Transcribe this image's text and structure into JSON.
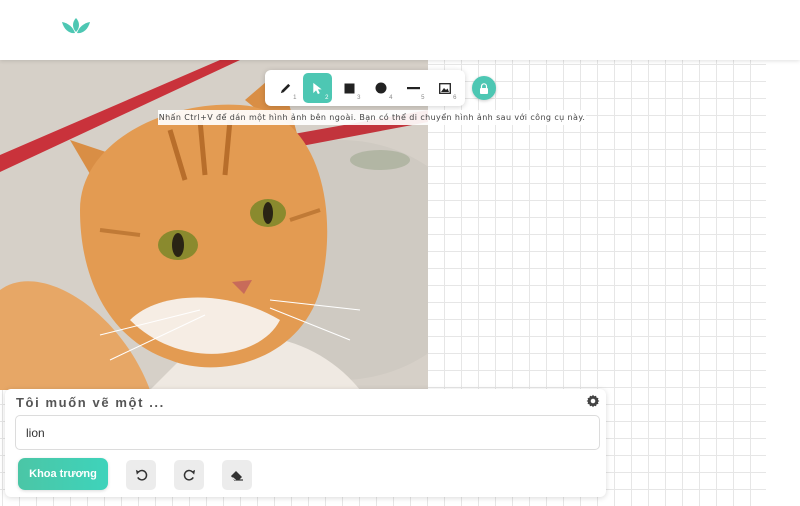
{
  "header": {
    "logo_icon": "leaf-logo-icon",
    "brand_color": "#4dc7b3"
  },
  "toolbar": {
    "tools": [
      {
        "name": "pencil",
        "icon": "pencil-icon",
        "shortcut": "1",
        "active": false
      },
      {
        "name": "select",
        "icon": "pointer-icon",
        "shortcut": "2",
        "active": true
      },
      {
        "name": "rectangle",
        "icon": "square-icon",
        "shortcut": "3",
        "active": false
      },
      {
        "name": "circle",
        "icon": "circle-icon",
        "shortcut": "4",
        "active": false
      },
      {
        "name": "line",
        "icon": "line-icon",
        "shortcut": "5",
        "active": false
      },
      {
        "name": "image",
        "icon": "image-icon",
        "shortcut": "6",
        "active": false
      }
    ],
    "lock_icon": "lock-icon",
    "hint": "Nhấn Ctrl+V để dán một hình ảnh bên ngoài. Bạn có thể di chuyển hình ảnh sau với công cụ này."
  },
  "canvas": {
    "image_description_icon": "pasted-photo"
  },
  "panel": {
    "title": "Tôi muốn vẽ một ...",
    "settings_icon": "gear-icon",
    "prompt_value": "lion",
    "generate_label": "Khoa trương",
    "undo_icon": "undo-icon",
    "redo_icon": "redo-icon",
    "clear_icon": "eraser-icon"
  }
}
